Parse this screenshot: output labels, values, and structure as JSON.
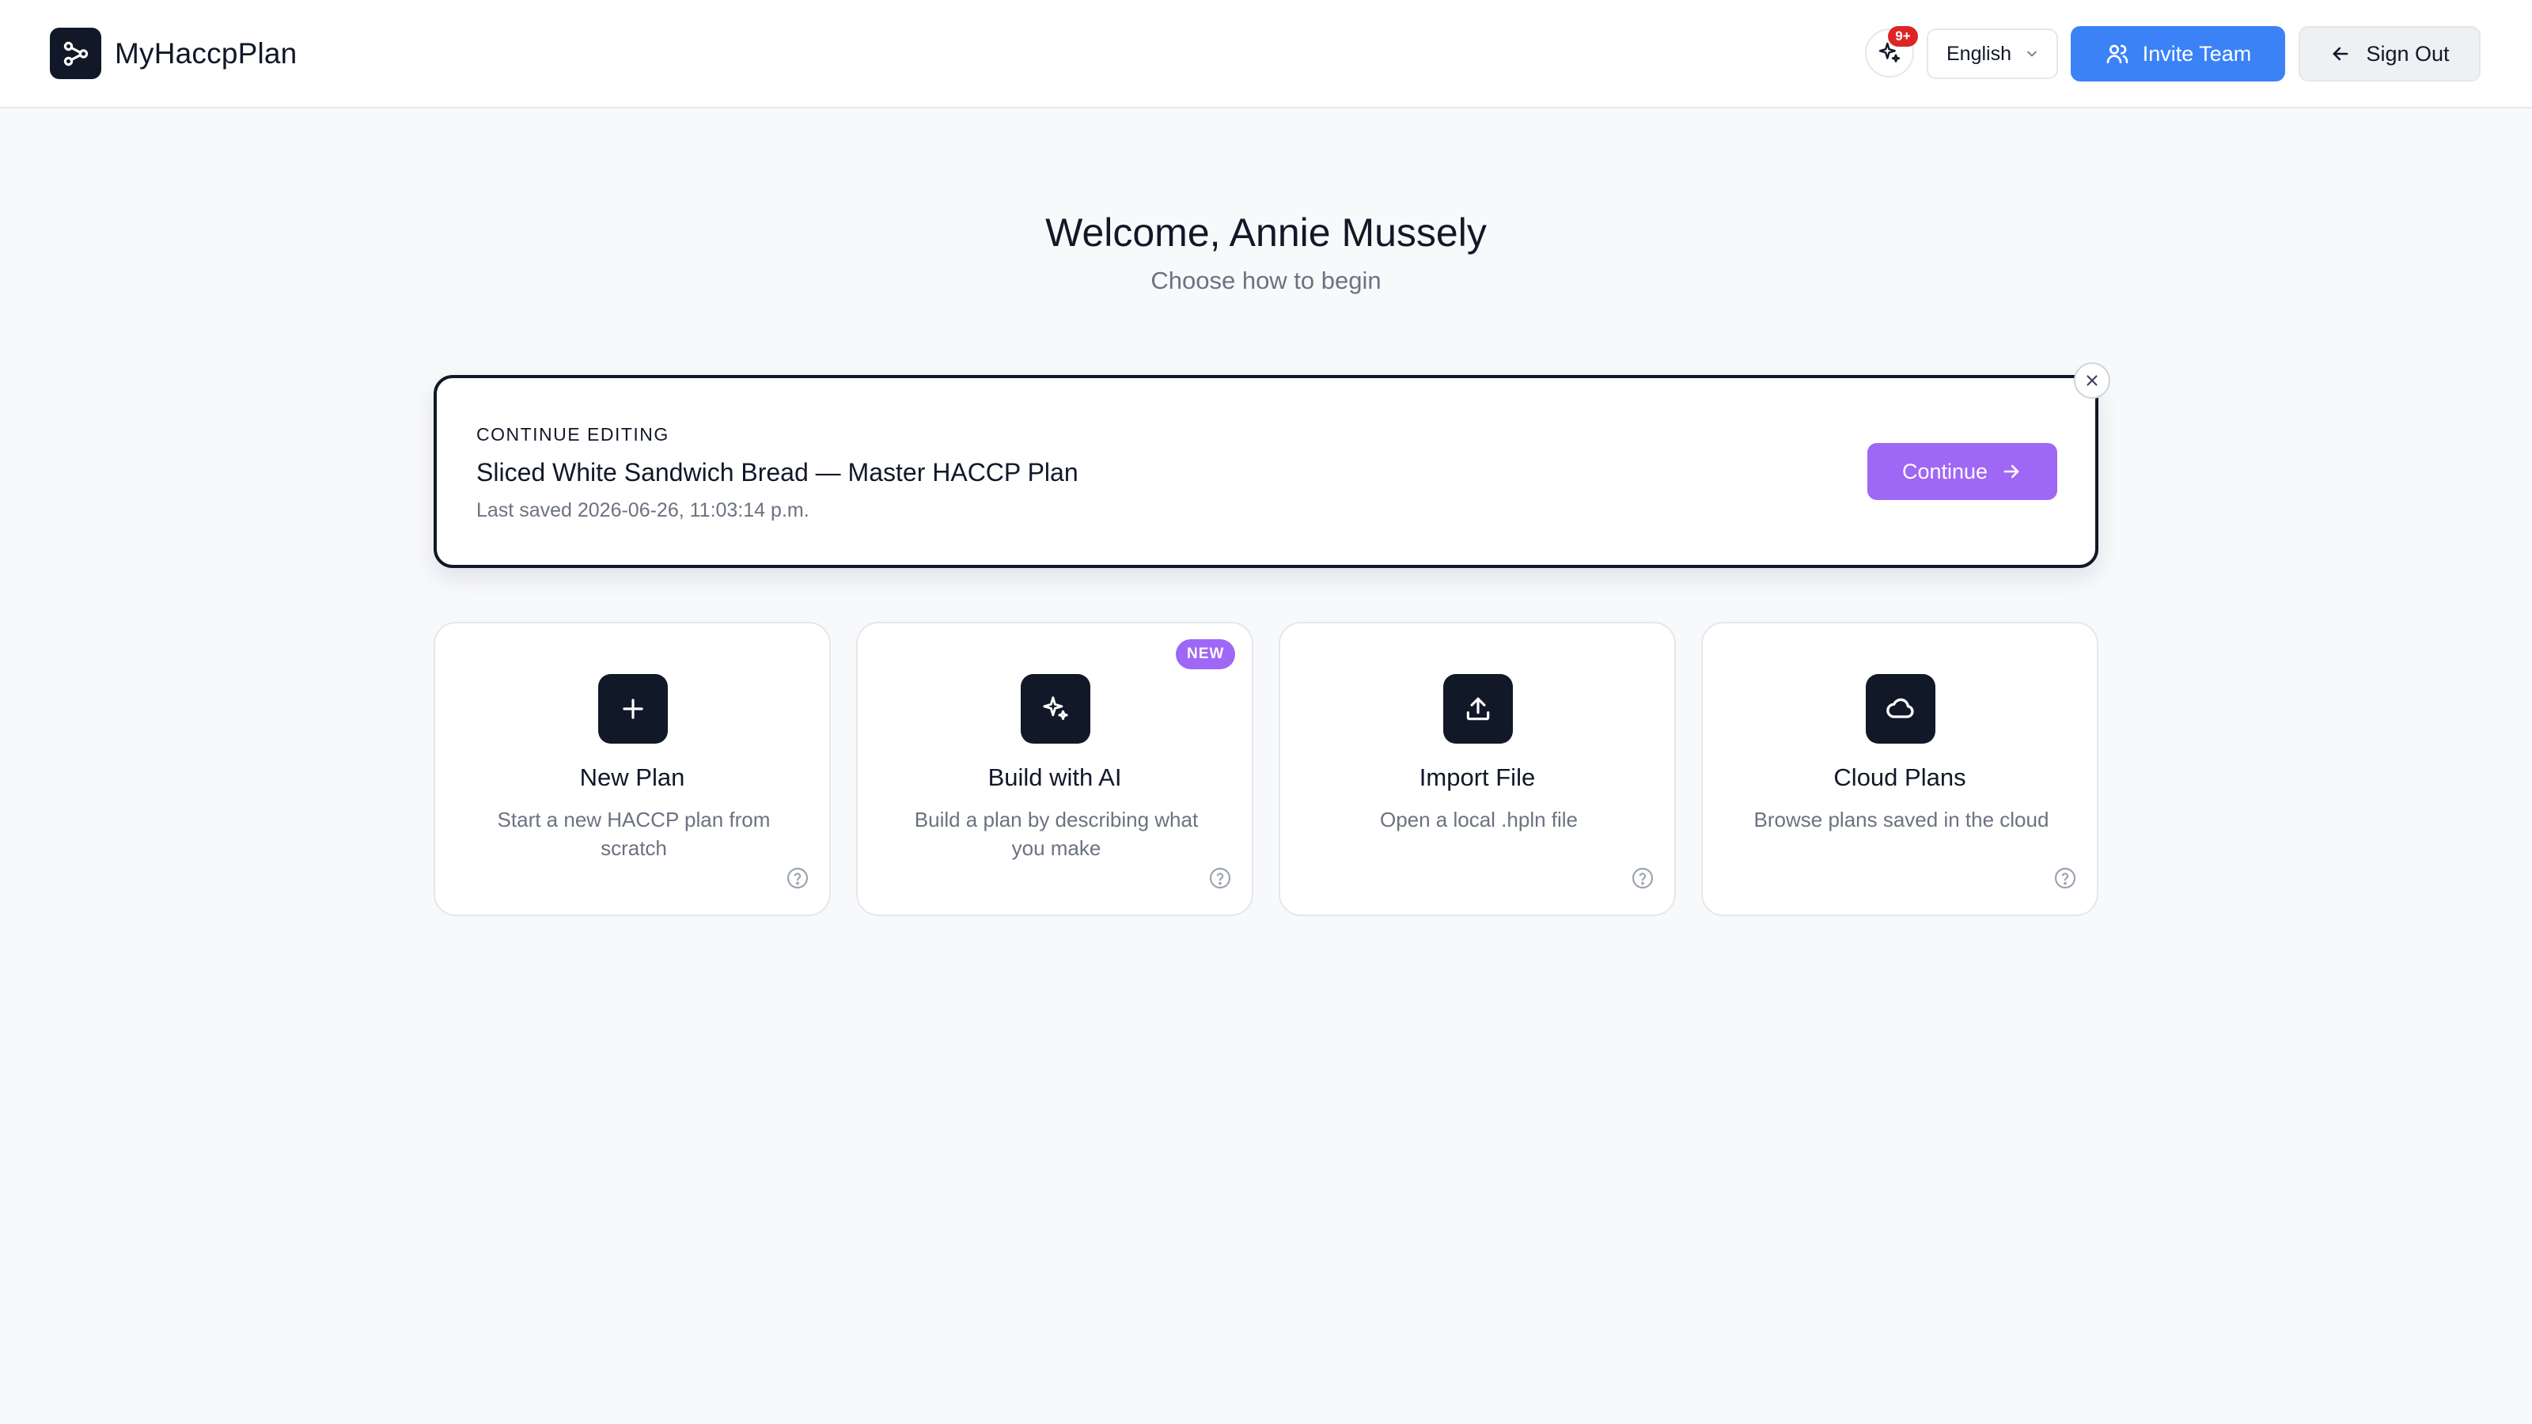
{
  "header": {
    "app_title": "MyHaccpPlan",
    "notification_badge": "9+",
    "language": "English",
    "invite_label": "Invite Team",
    "signout_label": "Sign Out",
    "icons": [
      "logo-icon",
      "sparkles-icon",
      "chevron-down-icon",
      "users-icon",
      "arrow-left-icon"
    ]
  },
  "welcome": {
    "title": "Welcome, Annie Mussely",
    "subtitle": "Choose how to begin"
  },
  "continue_editing": {
    "label": "CONTINUE EDITING",
    "plan_title": "Sliced White Sandwich Bread — Master HACCP Plan",
    "last_saved": "Last saved 2026-06-26, 11:03:14 p.m.",
    "button_label": "Continue",
    "dismiss_icon": "close-icon"
  },
  "options": [
    {
      "title": "New Plan",
      "description": "Start a new HACCP plan from scratch",
      "icon": "plus-icon"
    },
    {
      "title": "Build with AI",
      "description": "Build a plan by describing what you make",
      "icon": "sparkles-icon",
      "badge": "NEW"
    },
    {
      "title": "Import File",
      "description": "Open a local .hpln file",
      "icon": "upload-icon"
    },
    {
      "title": "Cloud Plans",
      "description": "Browse plans saved in the cloud",
      "icon": "cloud-icon"
    }
  ],
  "colors": {
    "primary_dark": "#111827",
    "accent_blue": "#3b82f6",
    "accent_purple": "#9f67f5",
    "badge_red": "#dc2626",
    "background": "#f8f9fb"
  }
}
